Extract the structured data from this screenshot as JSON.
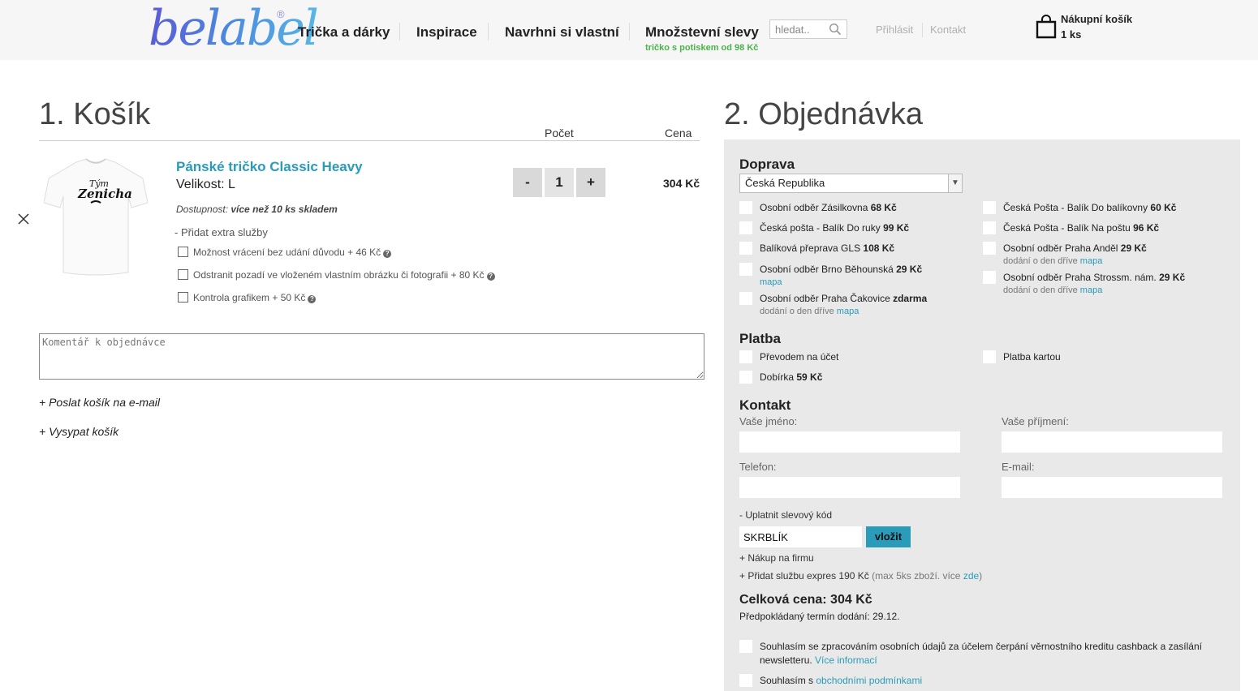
{
  "header": {
    "logo": "belabel",
    "logo_mark": "®",
    "nav": [
      "Trička a dárky",
      "Inspirace",
      "Navrhni si vlastní",
      "Množstevní slevy"
    ],
    "nav_sub": "tričko s potiskem od 98 Kč",
    "search_placeholder": "hledat..",
    "login": "Přihlásit",
    "contact": "Kontakt",
    "cart_title": "Nákupní košík",
    "cart_count": "1 ks"
  },
  "cart": {
    "heading": "1. Košík",
    "col_qty": "Počet",
    "col_price": "Cena",
    "item": {
      "name": "Pánské tričko Classic Heavy",
      "size": "Velikost: L",
      "avail_label": "Dostupnost: ",
      "avail_value": "více než 10 ks skladem",
      "qty": "1",
      "minus": "-",
      "plus": "+",
      "price": "304 Kč",
      "print_line1": "Tým",
      "print_line2": "Zenicha"
    },
    "extra_label": "- Přidat extra služby",
    "extras": [
      "Možnost vrácení bez udání důvodu + 46 Kč",
      "Odstranit pozadí ve vloženém vlastním obrázku či fotografii + 80 Kč",
      "Kontrola grafikem + 50 Kč"
    ],
    "help_glyph": "?",
    "comment_placeholder": "Komentář k objednávce",
    "send_email": "+ Poslat košík na e-mail",
    "empty_cart": "+ Vysypat košík"
  },
  "order": {
    "heading": "2. Objednávka",
    "shipping": {
      "title": "Doprava",
      "country": "Česká Republika",
      "options": [
        {
          "label": "Osobní odběr Zásilkovna ",
          "price": "68 Kč"
        },
        {
          "label": "Česká pošta - Balík Do ruky ",
          "price": "99 Kč"
        },
        {
          "label": "Balíková přeprava GLS ",
          "price": "108 Kč"
        },
        {
          "label": "Osobní odběr Brno Běhounská ",
          "price": "29 Kč",
          "link": "mapa"
        },
        {
          "label": "Osobní odběr Praha Čakovice ",
          "price": "zdarma",
          "note": "dodání o den dříve ",
          "link": "mapa"
        },
        {
          "label": "Česká Pošta - Balík Do balíkovny ",
          "price": "60 Kč"
        },
        {
          "label": "Česká Pošta - Balík Na poštu ",
          "price": "96 Kč"
        },
        {
          "label": "Osobní odběr Praha Anděl ",
          "price": "29 Kč",
          "note": "dodání o den dříve ",
          "link": "mapa"
        },
        {
          "label": "Osobní odběr Praha Strossm. nám. ",
          "price": "29 Kč",
          "note": "dodání o den dříve ",
          "link": "mapa"
        }
      ]
    },
    "payment": {
      "title": "Platba",
      "options": [
        {
          "label": "Převodem na účet",
          "price": ""
        },
        {
          "label": "Dobírka ",
          "price": "59 Kč"
        },
        {
          "label": "Platba kartou",
          "price": ""
        }
      ]
    },
    "contact": {
      "title": "Kontakt",
      "first_name": "Vaše jméno:",
      "last_name": "Vaše příjmení:",
      "phone": "Telefon:",
      "email": "E-mail:"
    },
    "discount_label": "- Uplatnit slevový kód",
    "discount_value": "SKRBLÍK",
    "apply": "vložit",
    "company": "+ Nákup na firmu",
    "express": "+ Přidat službu expres 190 Kč",
    "express_note": " (max 5ks zboží. více ",
    "express_link": "zde",
    "express_end": ")",
    "total": "Celková cena: 304 Kč",
    "delivery": "Předpokládaný termín dodání: 29.12.",
    "consent1": "Souhlasím se zpracováním osobních údajů za účelem čerpání věrnostního kreditu cashback a zasílání newsletteru. ",
    "consent1_link": "Více informací",
    "consent2": "Souhlasím s ",
    "consent2_link": "obchodními podmínkami"
  }
}
